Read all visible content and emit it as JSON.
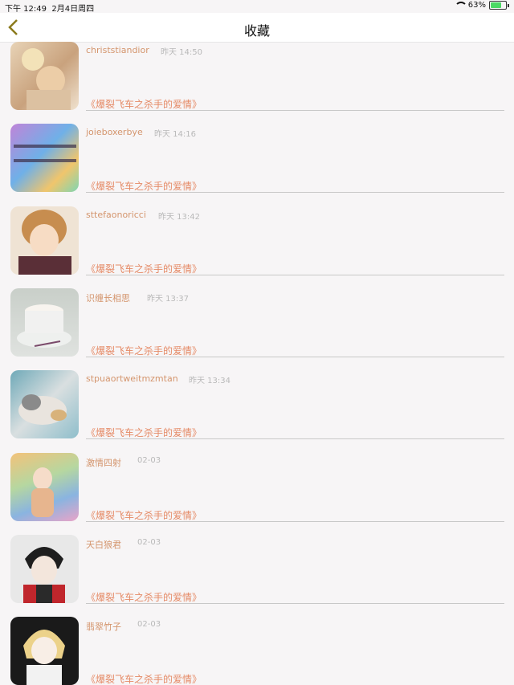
{
  "status_bar": {
    "time": "下午 12:49",
    "date": "2月4日周四",
    "battery": "63%"
  },
  "nav": {
    "title": "收藏",
    "back_icon": "chevron-left-icon",
    "accent": "#8b7a1c"
  },
  "items": [
    {
      "name": "christstiandior",
      "time": "昨天 14:50",
      "book": "《爆裂飞车之杀手的爱情》"
    },
    {
      "name": "joieboxerbye",
      "time": "昨天 14:16",
      "book": "《爆裂飞车之杀手的爱情》"
    },
    {
      "name": "sttefaonoricci",
      "time": "昨天 13:42",
      "book": "《爆裂飞车之杀手的爱情》"
    },
    {
      "name": "识缠长相思",
      "time": "昨天 13:37",
      "book": "《爆裂飞车之杀手的爱情》"
    },
    {
      "name": "stpuaortweitmzmtan",
      "time": "昨天 13:34",
      "book": "《爆裂飞车之杀手的爱情》"
    },
    {
      "name": "激情四射",
      "time": "02-03",
      "book": "《爆裂飞车之杀手的爱情》"
    },
    {
      "name": "天白狼君",
      "time": "02-03",
      "book": "《爆裂飞车之杀手的爱情》"
    },
    {
      "name": "翡翠竹子",
      "time": "02-03",
      "book": "《爆裂飞车之杀手的爱情》"
    }
  ]
}
